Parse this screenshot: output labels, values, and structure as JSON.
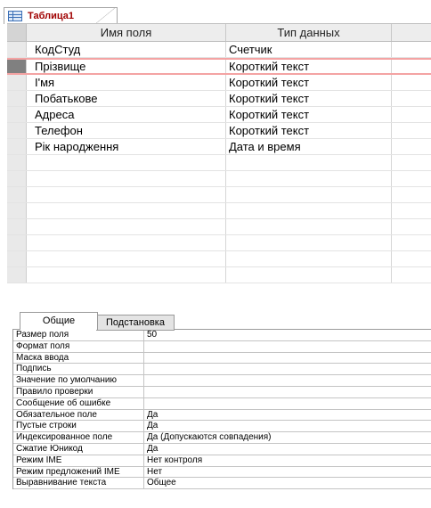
{
  "tab": {
    "title": "Таблица1"
  },
  "grid": {
    "columns": [
      "Имя поля",
      "Тип данных",
      ""
    ],
    "rows": [
      {
        "name": "КодСтуд",
        "type": "Счетчик"
      },
      {
        "name": "Прізвище",
        "type": "Короткий текст"
      },
      {
        "name": "І'мя",
        "type": "Короткий текст"
      },
      {
        "name": "Побатькове",
        "type": "Короткий текст"
      },
      {
        "name": "Адреса",
        "type": "Короткий текст"
      },
      {
        "name": "Телефон",
        "type": "Короткий текст"
      },
      {
        "name": "Рік народження",
        "type": "Дата и время"
      },
      {
        "name": "",
        "type": ""
      },
      {
        "name": "",
        "type": ""
      },
      {
        "name": "",
        "type": ""
      },
      {
        "name": "",
        "type": ""
      },
      {
        "name": "",
        "type": ""
      },
      {
        "name": "",
        "type": ""
      },
      {
        "name": "",
        "type": ""
      },
      {
        "name": "",
        "type": ""
      }
    ],
    "current_row": 1
  },
  "properties": {
    "tabs": [
      "Общие",
      "Подстановка"
    ],
    "rows": [
      {
        "key": "Размер поля",
        "value": "50"
      },
      {
        "key": "Формат поля",
        "value": ""
      },
      {
        "key": "Маска ввода",
        "value": ""
      },
      {
        "key": "Подпись",
        "value": ""
      },
      {
        "key": "Значение по умолчанию",
        "value": ""
      },
      {
        "key": "Правило проверки",
        "value": ""
      },
      {
        "key": "Сообщение об ошибке",
        "value": ""
      },
      {
        "key": "Обязательное поле",
        "value": "Да"
      },
      {
        "key": "Пустые строки",
        "value": "Да"
      },
      {
        "key": "Индексированное поле",
        "value": "Да (Допускаются совпадения)"
      },
      {
        "key": "Сжатие Юникод",
        "value": "Да"
      },
      {
        "key": "Режим IME",
        "value": "Нет контроля"
      },
      {
        "key": "Режим предложений IME",
        "value": "Нет"
      },
      {
        "key": "Выравнивание текста",
        "value": "Общее"
      }
    ]
  }
}
